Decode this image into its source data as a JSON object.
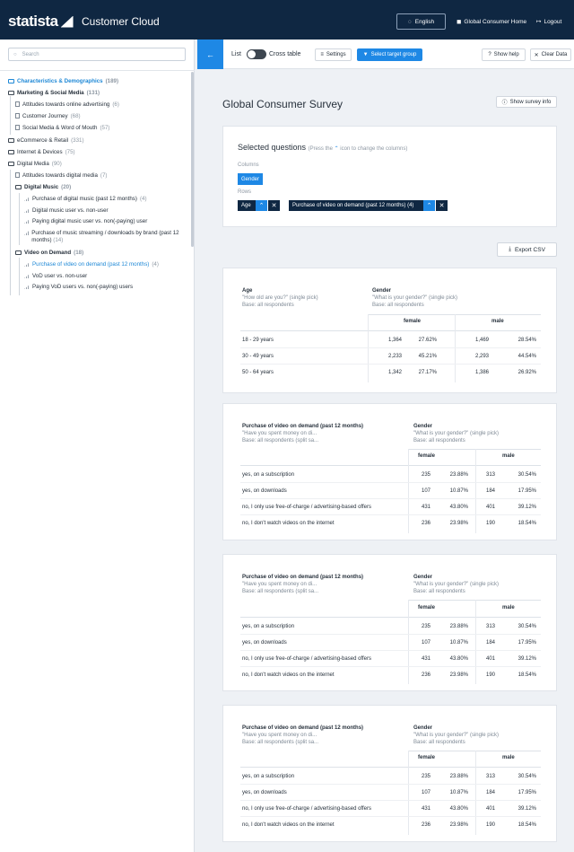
{
  "header": {
    "logo": "statista",
    "app_title": "Customer Cloud",
    "language": "English",
    "home_link": "Global Consumer Home",
    "logout": "Logout"
  },
  "sidebar": {
    "search_placeholder": "Search",
    "items": [
      {
        "label": "Characteristics & Demographics",
        "count": "(189)"
      },
      {
        "label": "Marketing & Social Media",
        "count": "(131)"
      },
      {
        "label": "Attitudes towards online advertising",
        "count": "(6)"
      },
      {
        "label": "Customer Journey",
        "count": "(68)"
      },
      {
        "label": "Social Media & Word of Mouth",
        "count": "(57)"
      },
      {
        "label": "eCommerce & Retail",
        "count": "(331)"
      },
      {
        "label": "Internet & Devices",
        "count": "(75)"
      },
      {
        "label": "Digital Media",
        "count": "(90)"
      },
      {
        "label": "Attitudes towards digital media",
        "count": "(7)"
      },
      {
        "label": "Digital Music",
        "count": "(20)"
      },
      {
        "label": "Purchase of digital music (past 12 months)",
        "count": "(4)"
      },
      {
        "label": "Digital music user vs. non-user",
        "count": ""
      },
      {
        "label": "Paying digital music user vs. non(-paying) user",
        "count": ""
      },
      {
        "label": "Purchase of music streaming / downloads by brand (past 12 months)",
        "count": "(14)"
      },
      {
        "label": "Video on Demand",
        "count": "(18)"
      },
      {
        "label": "Purchase of video on demand (past 12 months)",
        "count": "(4)"
      },
      {
        "label": "VoD user vs. non-user",
        "count": ""
      },
      {
        "label": "Paying VoD users vs. non(-paying) users",
        "count": ""
      }
    ]
  },
  "toolbar": {
    "list": "List",
    "cross_table": "Cross table",
    "settings": "Settings",
    "select_target_group": "Select target group",
    "show_help": "Show help",
    "clear_data": "Clear Data"
  },
  "page": {
    "title": "Global Consumer Survey",
    "show_survey_info": "Show survey info",
    "export_csv": "Export CSV"
  },
  "selected_questions": {
    "title": "Selected questions",
    "hint_before": "(Press the",
    "hint_after": "icon to change the columns)",
    "columns_label": "Columns",
    "column_chip": "Gender",
    "rows_label": "Rows",
    "row_chips": [
      "Age",
      "Purchase of video on demand (past 12 months) (4)"
    ]
  },
  "tables": [
    {
      "row_title": "Age",
      "row_sub1": "\"How old are you?\" (single pick)",
      "row_sub2": "Base: all respondents",
      "col_title": "Gender",
      "col_sub1": "\"What is your gender?\" (single pick)",
      "col_sub2": "Base: all respondents",
      "groups": [
        "female",
        "male"
      ],
      "rows": [
        {
          "label": "18 - 29 years",
          "f_n": "1,364",
          "f_p": "27.62%",
          "m_n": "1,469",
          "m_p": "28.54%"
        },
        {
          "label": "30 - 49 years",
          "f_n": "2,233",
          "f_p": "45.21%",
          "m_n": "2,293",
          "m_p": "44.54%"
        },
        {
          "label": "50 - 64 years",
          "f_n": "1,342",
          "f_p": "27.17%",
          "m_n": "1,386",
          "m_p": "26.92%"
        }
      ]
    },
    {
      "row_title": "Purchase of video on demand (past 12 months)",
      "row_sub1": "\"Have you spent money on di...",
      "row_sub2": "Base: all respondents (split sa...",
      "col_title": "Gender",
      "col_sub1": "\"What is your gender?\" (single pick)",
      "col_sub2": "Base: all respondents",
      "groups": [
        "female",
        "male"
      ],
      "rows": [
        {
          "label": "yes, on a subscription",
          "f_n": "235",
          "f_p": "23.88%",
          "m_n": "313",
          "m_p": "30.54%"
        },
        {
          "label": "yes, on downloads",
          "f_n": "107",
          "f_p": "10.87%",
          "m_n": "184",
          "m_p": "17.95%"
        },
        {
          "label": "no, I only use free-of-charge / advertising-based offers",
          "f_n": "431",
          "f_p": "43.80%",
          "m_n": "401",
          "m_p": "39.12%"
        },
        {
          "label": "no, I don't watch videos on the internet",
          "f_n": "236",
          "f_p": "23.98%",
          "m_n": "190",
          "m_p": "18.54%"
        }
      ]
    },
    {
      "row_title": "Purchase of video on demand (past 12 months)",
      "row_sub1": "\"Have you spent money on di...",
      "row_sub2": "Base: all respondents (split sa...",
      "col_title": "Gender",
      "col_sub1": "\"What is your gender?\" (single pick)",
      "col_sub2": "Base: all respondents",
      "groups": [
        "female",
        "male"
      ],
      "rows": [
        {
          "label": "yes, on a subscription",
          "f_n": "235",
          "f_p": "23.88%",
          "m_n": "313",
          "m_p": "30.54%"
        },
        {
          "label": "yes, on downloads",
          "f_n": "107",
          "f_p": "10.87%",
          "m_n": "184",
          "m_p": "17.95%"
        },
        {
          "label": "no, I only use free-of-charge / advertising-based offers",
          "f_n": "431",
          "f_p": "43.80%",
          "m_n": "401",
          "m_p": "39.12%"
        },
        {
          "label": "no, I don't watch videos on the internet",
          "f_n": "236",
          "f_p": "23.98%",
          "m_n": "190",
          "m_p": "18.54%"
        }
      ]
    },
    {
      "row_title": "Purchase of video on demand (past 12 months)",
      "row_sub1": "\"Have you spent money on di...",
      "row_sub2": "Base: all respondents (split sa...",
      "col_title": "Gender",
      "col_sub1": "\"What is your gender?\" (single pick)",
      "col_sub2": "Base: all respondents",
      "groups": [
        "female",
        "male"
      ],
      "rows": [
        {
          "label": "yes, on a subscription",
          "f_n": "235",
          "f_p": "23.88%",
          "m_n": "313",
          "m_p": "30.54%"
        },
        {
          "label": "yes, on downloads",
          "f_n": "107",
          "f_p": "10.87%",
          "m_n": "184",
          "m_p": "17.95%"
        },
        {
          "label": "no, I only use free-of-charge / advertising-based offers",
          "f_n": "431",
          "f_p": "43.80%",
          "m_n": "401",
          "m_p": "39.12%"
        },
        {
          "label": "no, I don't watch videos on the internet",
          "f_n": "236",
          "f_p": "23.98%",
          "m_n": "190",
          "m_p": "18.54%"
        }
      ]
    }
  ]
}
